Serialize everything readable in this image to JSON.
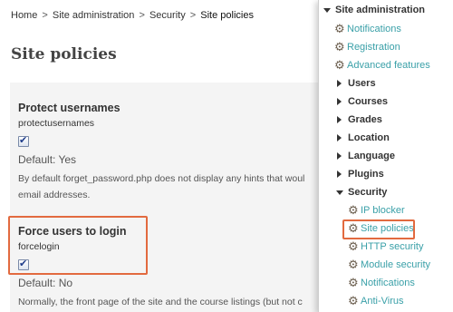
{
  "breadcrumb": {
    "items": [
      "Home",
      "Site administration",
      "Security"
    ],
    "separator": ">",
    "current": "Site policies"
  },
  "page": {
    "title": "Site policies"
  },
  "settings": [
    {
      "name": "Protect usernames",
      "key": "protectusernames",
      "checked": true,
      "default": "Default: Yes",
      "description": [
        "By default forget_password.php does not display any hints that woul",
        "email addresses."
      ]
    },
    {
      "name": "Force users to login",
      "key": "forcelogin",
      "checked": true,
      "default": "Default: No",
      "description": [
        "Normally, the front page of the site and the course listings (but not c"
      ]
    }
  ],
  "admin_menu": {
    "header": "Site administration",
    "links": [
      "Notifications",
      "Registration",
      "Advanced features"
    ],
    "categories": [
      "Users",
      "Courses",
      "Grades",
      "Location",
      "Language",
      "Plugins"
    ],
    "security": {
      "label": "Security",
      "items": [
        "IP blocker",
        "Site policies",
        "HTTP security",
        "Module security",
        "Notifications",
        "Anti-Virus"
      ]
    }
  },
  "colors": {
    "link": "#3aa0a8",
    "highlight": "#e26a3f",
    "panel_background": "#f4f4f4"
  },
  "icons": [
    "gear-icon",
    "arrow-down-icon",
    "arrow-right-icon",
    "checkbox-checked-icon"
  ]
}
